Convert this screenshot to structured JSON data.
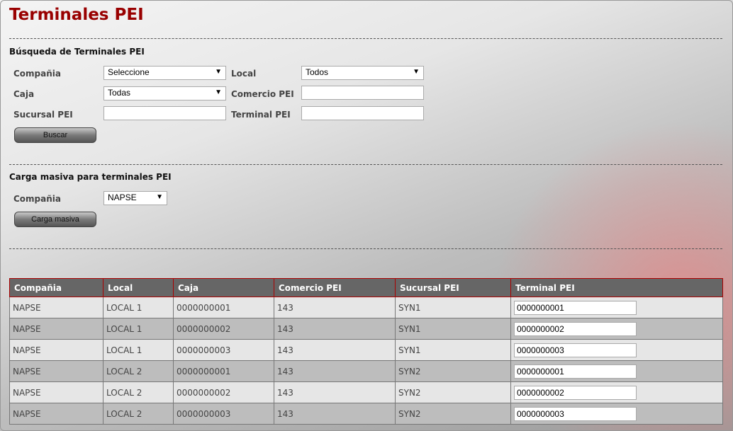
{
  "title": "Terminales PEI",
  "search": {
    "heading": "Búsqueda de Terminales PEI",
    "compania_label": "Compañia",
    "compania_value": "Seleccione",
    "local_label": "Local",
    "local_value": "Todos",
    "caja_label": "Caja",
    "caja_value": "Todas",
    "comercio_label": "Comercio PEI",
    "comercio_value": "",
    "sucursal_label": "Sucursal PEI",
    "sucursal_value": "",
    "terminal_label": "Terminal PEI",
    "terminal_value": "",
    "button": "Buscar"
  },
  "bulk": {
    "heading": "Carga masiva para terminales PEI",
    "compania_label": "Compañia",
    "compania_value": "NAPSE",
    "button": "Carga masiva"
  },
  "table": {
    "headers": [
      "Compañia",
      "Local",
      "Caja",
      "Comercio PEI",
      "Sucursal PEI",
      "Terminal PEI"
    ],
    "rows": [
      [
        "NAPSE",
        "LOCAL 1",
        "0000000001",
        "143",
        "SYN1",
        "0000000001"
      ],
      [
        "NAPSE",
        "LOCAL 1",
        "0000000002",
        "143",
        "SYN1",
        "0000000002"
      ],
      [
        "NAPSE",
        "LOCAL 1",
        "0000000003",
        "143",
        "SYN1",
        "0000000003"
      ],
      [
        "NAPSE",
        "LOCAL 2",
        "0000000001",
        "143",
        "SYN2",
        "0000000001"
      ],
      [
        "NAPSE",
        "LOCAL 2",
        "0000000002",
        "143",
        "SYN2",
        "0000000002"
      ],
      [
        "NAPSE",
        "LOCAL 2",
        "0000000003",
        "143",
        "SYN2",
        "0000000003"
      ]
    ]
  }
}
